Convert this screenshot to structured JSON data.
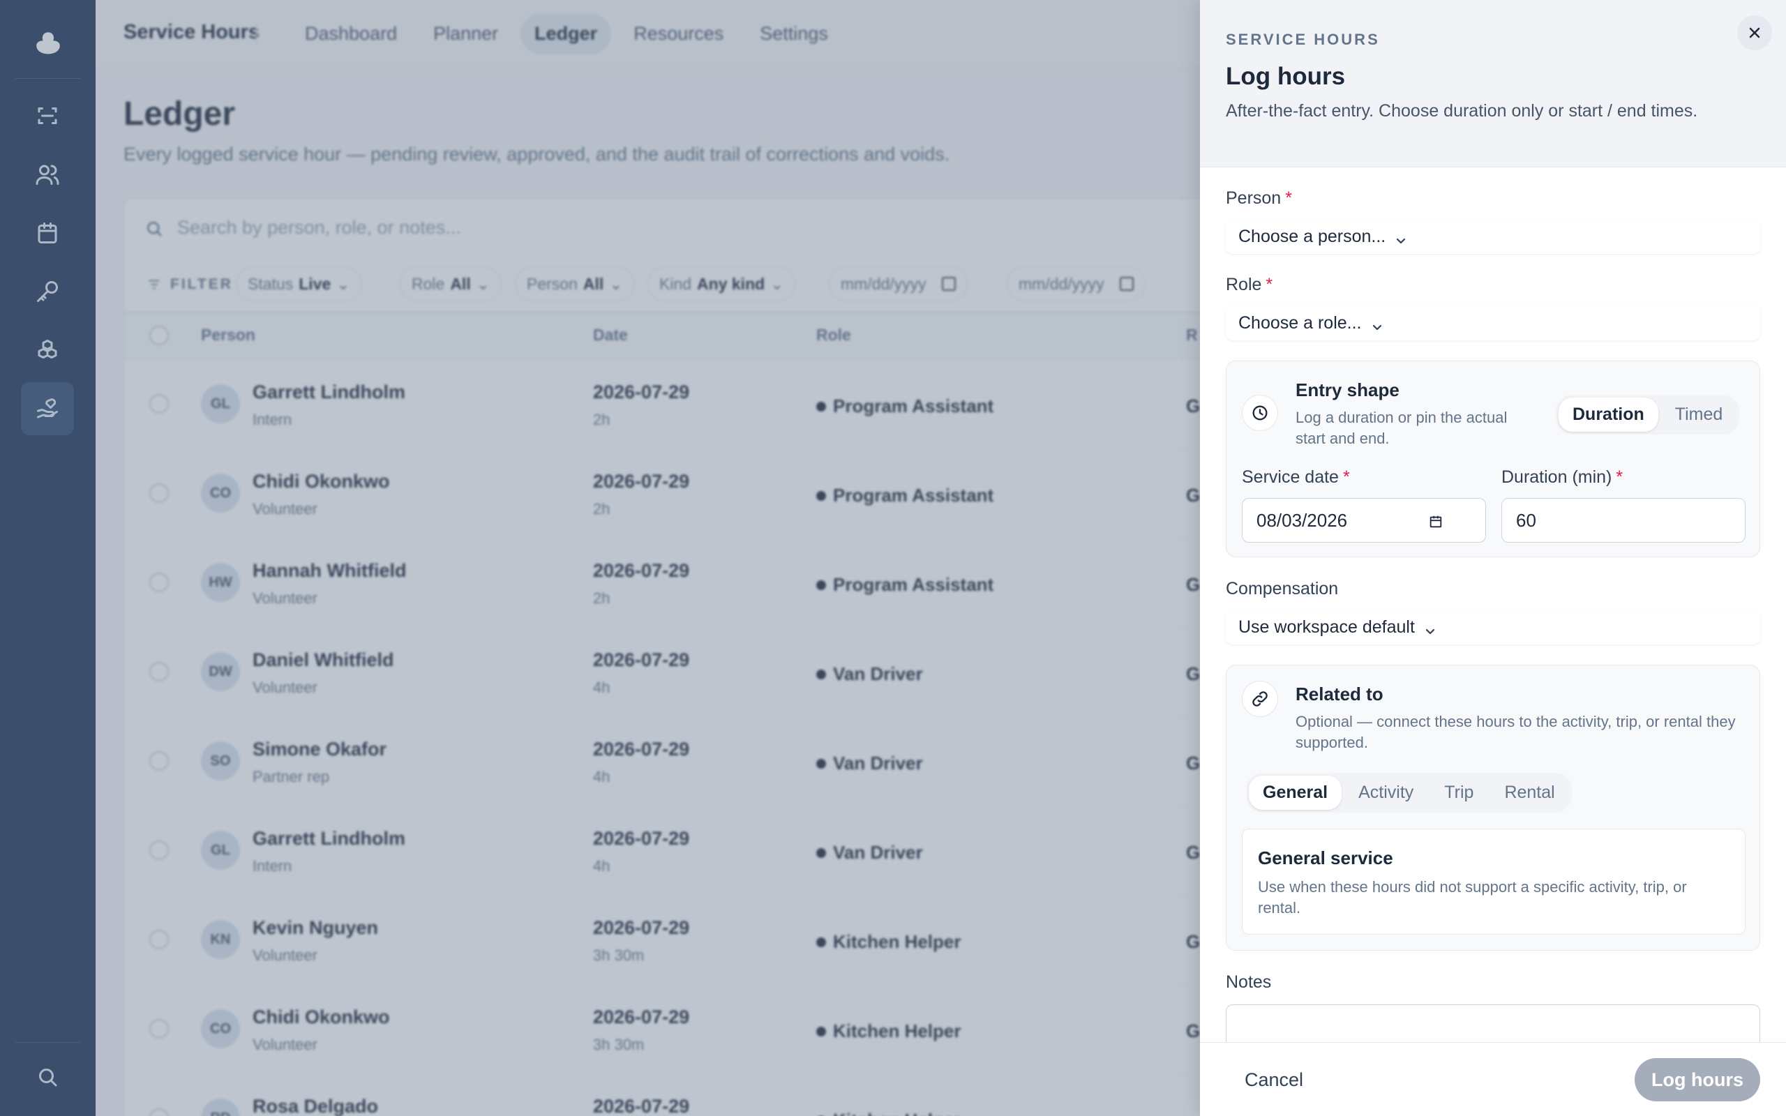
{
  "rail": {
    "icons": [
      "logo-icon",
      "scan-icon",
      "users-icon",
      "calendar-icon",
      "key-icon",
      "boxes-icon",
      "hand-heart-icon",
      "search-icon"
    ],
    "active_index": 5
  },
  "topbar": {
    "brand": "Service Hours",
    "tabs": [
      "Dashboard",
      "Planner",
      "Ledger",
      "Resources",
      "Settings"
    ],
    "active_tab": "Ledger"
  },
  "page": {
    "title": "Ledger",
    "subtitle": "Every logged service hour — pending review, approved, and the audit trail of corrections and voids."
  },
  "search": {
    "placeholder": "Search by person, role, or notes..."
  },
  "filters": {
    "label": "FILTER",
    "status": {
      "label": "Status",
      "value": "Live"
    },
    "role": {
      "label": "Role",
      "value": "All"
    },
    "person": {
      "label": "Person",
      "value": "All"
    },
    "kind": {
      "label": "Kind",
      "value": "Any kind"
    },
    "date_from": "mm/dd/yyyy",
    "date_to": "mm/dd/yyyy"
  },
  "table": {
    "columns": [
      "Person",
      "Date",
      "Role",
      "R"
    ],
    "rows": [
      {
        "initials": "GL",
        "name": "Garrett Lindholm",
        "type": "Intern",
        "date": "2026-07-29",
        "duration": "2h",
        "role": "Program Assistant",
        "extra": "G"
      },
      {
        "initials": "CO",
        "name": "Chidi Okonkwo",
        "type": "Volunteer",
        "date": "2026-07-29",
        "duration": "2h",
        "role": "Program Assistant",
        "extra": "G"
      },
      {
        "initials": "HW",
        "name": "Hannah Whitfield",
        "type": "Volunteer",
        "date": "2026-07-29",
        "duration": "2h",
        "role": "Program Assistant",
        "extra": "G"
      },
      {
        "initials": "DW",
        "name": "Daniel Whitfield",
        "type": "Volunteer",
        "date": "2026-07-29",
        "duration": "4h",
        "role": "Van Driver",
        "extra": "G"
      },
      {
        "initials": "SO",
        "name": "Simone Okafor",
        "type": "Partner rep",
        "date": "2026-07-29",
        "duration": "4h",
        "role": "Van Driver",
        "extra": "G"
      },
      {
        "initials": "GL",
        "name": "Garrett Lindholm",
        "type": "Intern",
        "date": "2026-07-29",
        "duration": "4h",
        "role": "Van Driver",
        "extra": "G"
      },
      {
        "initials": "KN",
        "name": "Kevin Nguyen",
        "type": "Volunteer",
        "date": "2026-07-29",
        "duration": "3h 30m",
        "role": "Kitchen Helper",
        "extra": "G"
      },
      {
        "initials": "CO",
        "name": "Chidi Okonkwo",
        "type": "Volunteer",
        "date": "2026-07-29",
        "duration": "3h 30m",
        "role": "Kitchen Helper",
        "extra": "G"
      },
      {
        "initials": "RD",
        "name": "Rosa Delgado",
        "type": "",
        "date": "2026-07-29",
        "duration": "",
        "role": "Kitchen Helper",
        "extra": ""
      }
    ]
  },
  "drawer": {
    "eyebrow": "SERVICE HOURS",
    "title": "Log hours",
    "subtitle": "After-the-fact entry. Choose duration only or start / end times.",
    "person": {
      "label": "Person",
      "required_mark": "*",
      "value": "Choose a person..."
    },
    "role": {
      "label": "Role",
      "required_mark": "*",
      "value": "Choose a role..."
    },
    "entry_shape": {
      "title": "Entry shape",
      "subtitle": "Log a duration or pin the actual start and end.",
      "options": [
        "Duration",
        "Timed"
      ],
      "active": "Duration",
      "service_date": {
        "label": "Service date",
        "required_mark": "*",
        "value": "08/03/2026"
      },
      "duration": {
        "label": "Duration (min)",
        "required_mark": "*",
        "value": "60"
      }
    },
    "compensation": {
      "label": "Compensation",
      "value": "Use workspace default"
    },
    "related": {
      "title": "Related to",
      "subtitle": "Optional — connect these hours to the activity, trip, or rental they supported.",
      "tabs": [
        "General",
        "Activity",
        "Trip",
        "Rental"
      ],
      "active": "General",
      "panel_title": "General service",
      "panel_text": "Use when these hours did not support a specific activity, trip, or rental."
    },
    "notes": {
      "label": "Notes",
      "value": ""
    },
    "footer": {
      "cancel": "Cancel",
      "submit": "Log hours"
    }
  }
}
